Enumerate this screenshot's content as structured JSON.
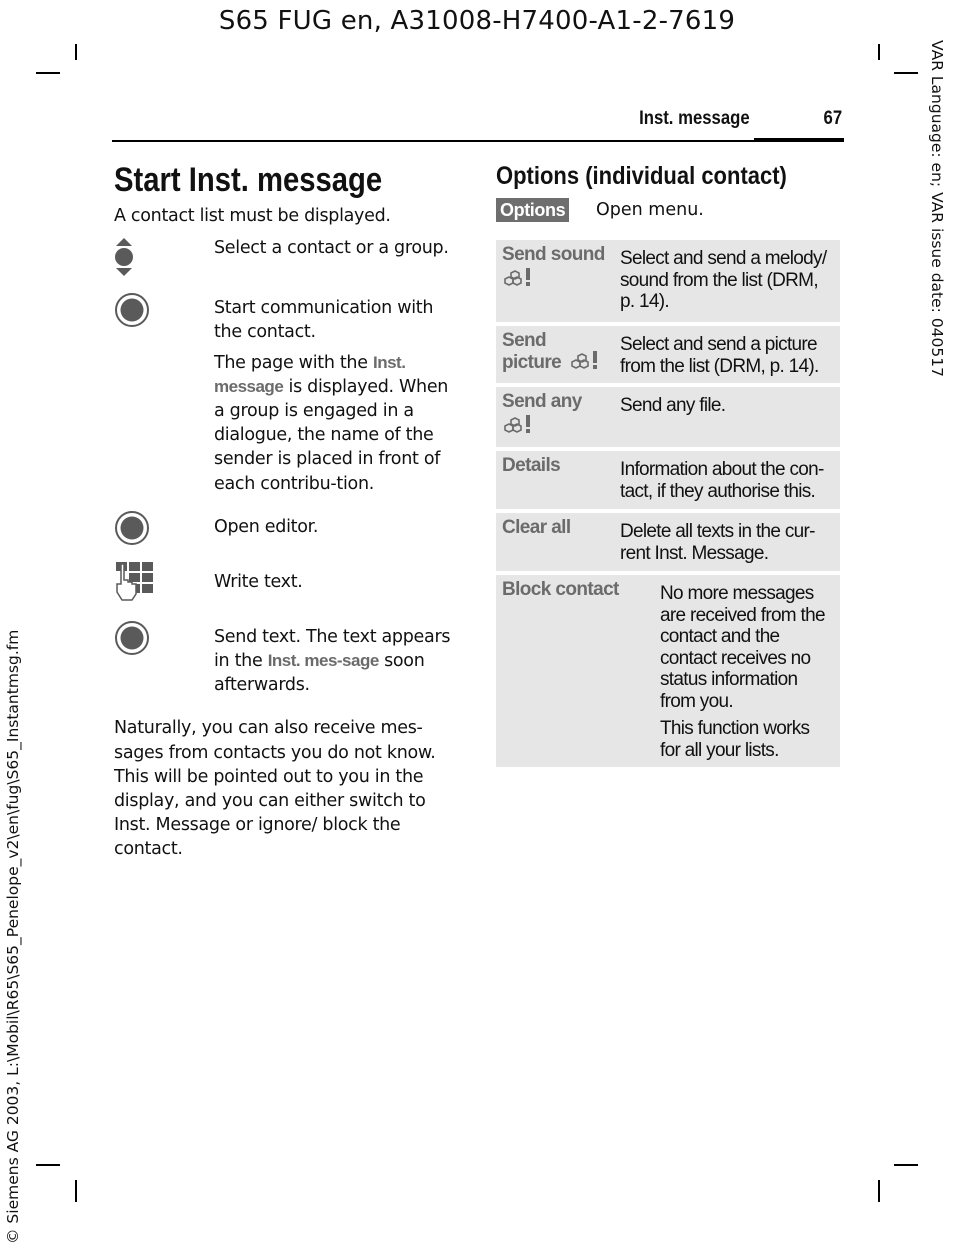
{
  "document_header": "S65 FUG en, A31008-H7400-A1-2-7619",
  "side_note_right": "VAR Language: en; VAR issue date: 040517",
  "side_note_left": "© Siemens AG 2003, L:\\Mobil\\R65\\S65_Penelope_v2\\en\\fug\\S65_Instantmsg.fm",
  "running_head": {
    "section": "Inst. message",
    "page_number": "67"
  },
  "left_column": {
    "title": "Start Inst. message",
    "intro": "A contact list must be displayed.",
    "steps": [
      {
        "icon": "control-key-up-down-icon",
        "text": "Select a contact or a group."
      },
      {
        "icon": "control-key-press-icon",
        "text": "Start communication with the contact."
      },
      {
        "icon": null,
        "text_before": "The page with the ",
        "term": "Inst. message",
        "text_after": " is displayed. When a group is engaged in a dialogue, the name of the sender is placed in front of each contribu-tion."
      },
      {
        "icon": "control-key-press-icon",
        "text": "Open editor."
      },
      {
        "icon": "keypad-hand-icon",
        "text": "Write text."
      },
      {
        "icon": "control-key-press-icon",
        "text_before": "Send text. The text appears in the ",
        "term": "Inst. mes-sage",
        "text_after": " soon afterwards."
      }
    ],
    "closing_paragraph": "Naturally, you can also receive mes-sages from contacts you do not know. This will be pointed out to you in the display, and you can either switch to Inst. Message or ignore/ block the contact."
  },
  "right_column": {
    "title": "Options (individual contact)",
    "options_key": {
      "label": "Options",
      "description": "Open menu."
    },
    "options": [
      {
        "name": "Send sound",
        "drm": true,
        "description": [
          "Select and send a melody/ sound from the list (DRM, p. 14)."
        ]
      },
      {
        "name": "Send picture",
        "drm": true,
        "description": [
          "Select and send a picture from the list (DRM, p. 14)."
        ]
      },
      {
        "name": "Send any",
        "drm": true,
        "description": [
          "Send any file."
        ]
      },
      {
        "name": "Details",
        "drm": false,
        "description": [
          "Information about the con-tact, if they authorise this."
        ]
      },
      {
        "name": "Clear all",
        "drm": false,
        "description": [
          "Delete all texts in the cur-rent Inst. Message."
        ]
      },
      {
        "name": "Block contact",
        "drm": false,
        "description": [
          "No more messages are received from the contact and the contact receives no status information from you.",
          "This function works for all your lists."
        ]
      }
    ]
  },
  "colors": {
    "ui_term_gray": "#6b6b6b",
    "badge_bg": "#6e6e6e",
    "table_row_bg": "#e6e6e6",
    "icon_gray": "#5a5a5a"
  }
}
